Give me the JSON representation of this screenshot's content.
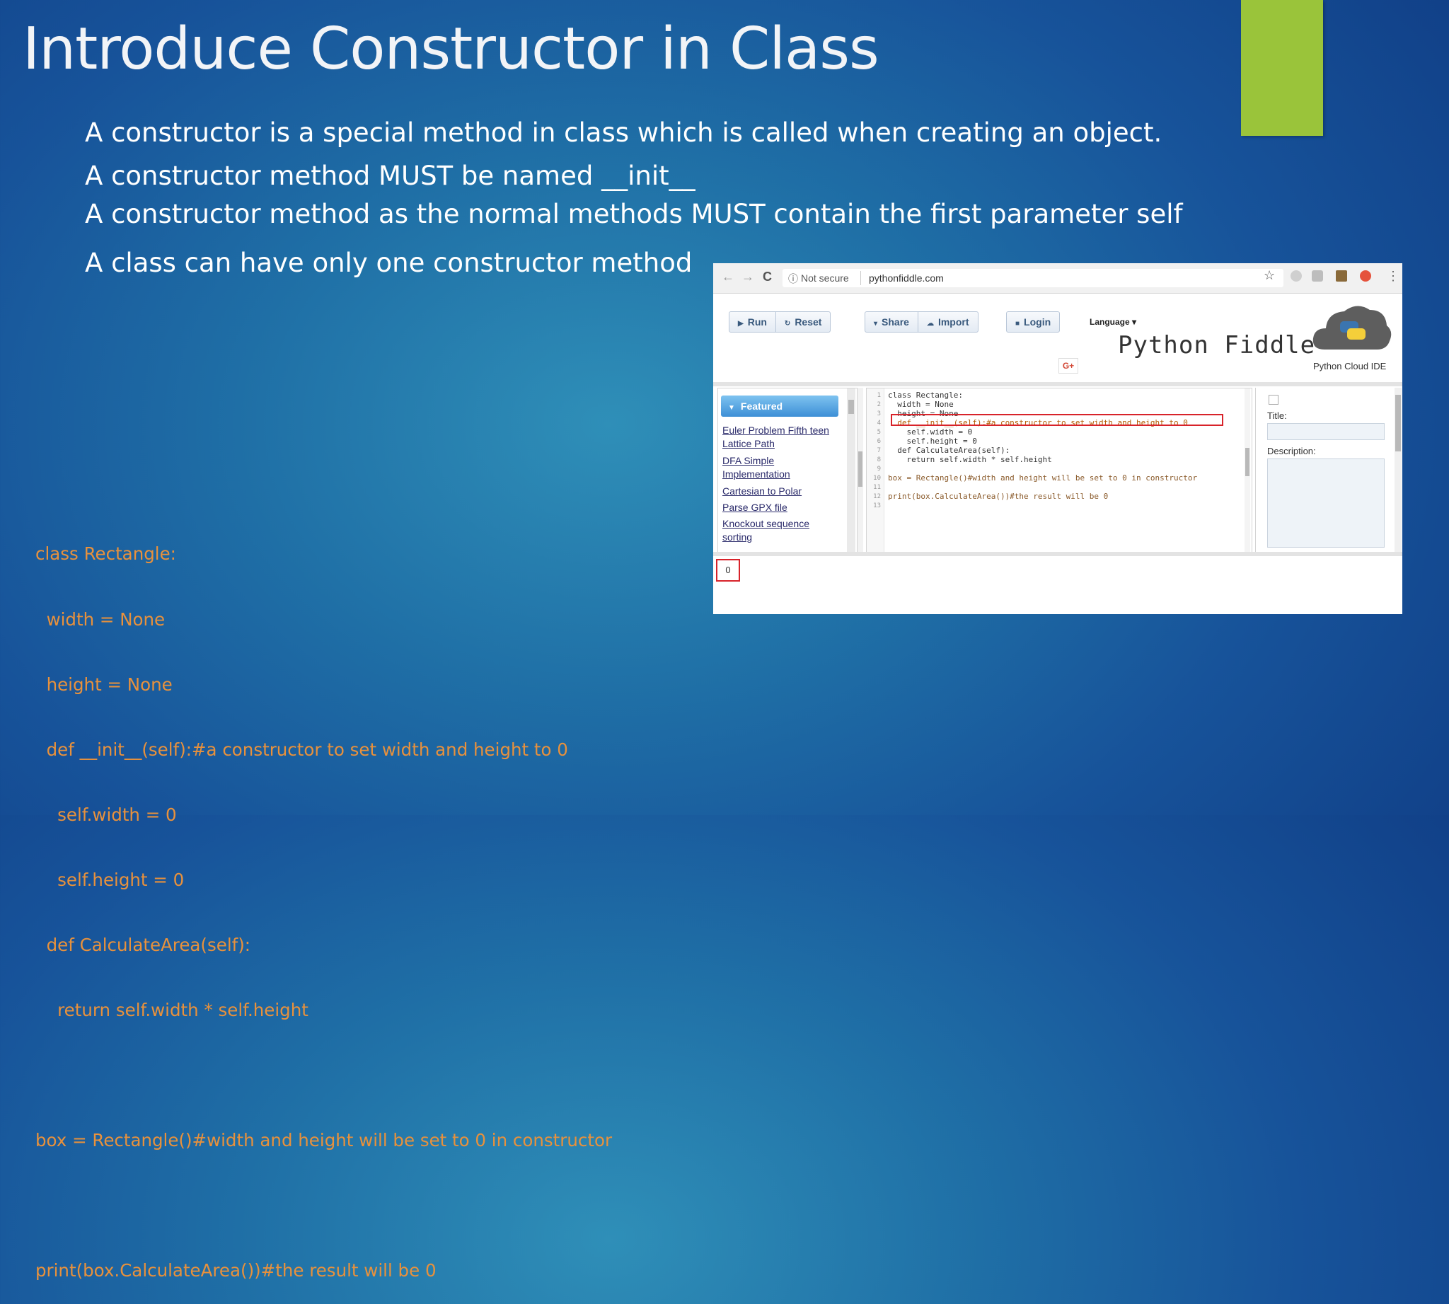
{
  "slide": {
    "title": "Introduce Constructor in Class",
    "bullets": [
      "A constructor is a special method in class which is called when creating an object.",
      "A constructor method MUST be named __init__",
      "A constructor method as the normal methods MUST contain the first parameter self",
      "A class can have only one constructor method"
    ],
    "code_lines": [
      "class Rectangle:",
      "  width = None",
      "  height = None",
      "  def __init__(self):#a constructor to set width and height to 0",
      "    self.width = 0",
      "    self.height = 0",
      "  def CalculateArea(self):",
      "    return self.width * self.height",
      "",
      "box = Rectangle()#width and height will be set to 0 in constructor",
      "",
      "print(box.CalculateArea())#the result will be 0"
    ],
    "colors": {
      "accent": "#9ac43a",
      "code": "#e8913c",
      "title": "#f2f4f7"
    }
  },
  "browser": {
    "nav": {
      "back": "←",
      "forward": "→",
      "reload": "C"
    },
    "security_label": "Not secure",
    "url": "pythonfiddle.com",
    "toolbar": {
      "run": "Run",
      "reset": "Reset",
      "share": "Share",
      "import": "Import",
      "login": "Login",
      "language": "Language ▾"
    },
    "gplus": "G+",
    "brand_name": "Python Fiddle",
    "brand_tagline": "Python Cloud IDE",
    "featured_header": "Featured",
    "featured_items": [
      "Euler Problem Fifth teen Lattice Path",
      "DFA Simple Implementation",
      "Cartesian to Polar",
      "Parse GPX file",
      "Knockout sequence sorting"
    ],
    "line_numbers": [
      "1",
      "2",
      "3",
      "4",
      "5",
      "6",
      "7",
      "8",
      "9",
      "10",
      "11",
      "12",
      "13"
    ],
    "editor_lines": [
      "class Rectangle:",
      "  width = None",
      "  height = None",
      "  def __init__(self):#a constructor to set width and height to 0",
      "    self.width = 0",
      "    self.height = 0",
      "  def CalculateArea(self):",
      "    return self.width * self.height",
      "",
      "box = Rectangle()#width and height will be set to 0 in constructor",
      "",
      "print(box.CalculateArea())#the result will be 0",
      ""
    ],
    "right_panel": {
      "title_label": "Title:",
      "description_label": "Description:"
    },
    "output": "0"
  }
}
